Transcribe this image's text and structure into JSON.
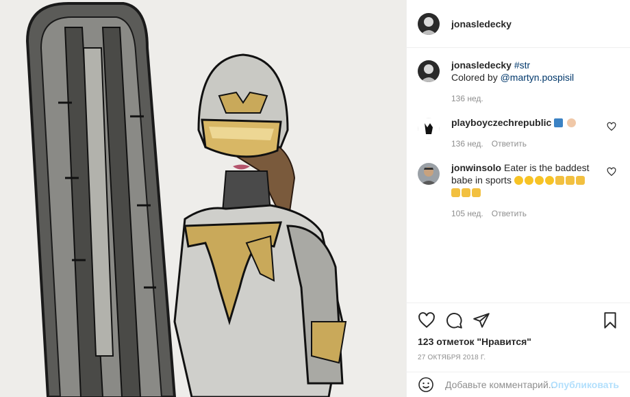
{
  "post": {
    "author": "jonasledecky",
    "media_label": "illustration-female-rider-with-snowboard"
  },
  "caption": {
    "author": "jonasledecky",
    "hashtag": "#str",
    "line2_prefix": "Colored by ",
    "mention": "@martyn.pospisil",
    "time": "136 нед."
  },
  "comments": [
    {
      "author": "playboyczechrepublic",
      "text": "",
      "emoji": [
        "anchor",
        "like"
      ],
      "time": "136 нед.",
      "reply": "Ответить"
    },
    {
      "author": "jonwinsolo",
      "text": "Eater is the baddest babe in sports",
      "emoji": [
        "heart-eyes",
        "heart-eyes",
        "heart-eyes",
        "heart-eyes",
        "horns",
        "horns",
        "horns",
        "horns",
        "horns",
        "horns"
      ],
      "time": "105 нед.",
      "reply": "Ответить"
    }
  ],
  "actions": {
    "likes": "123 отметок \"Нравится\"",
    "date": "27 ОКТЯБРЯ 2018 Г."
  },
  "add_comment": {
    "placeholder": "Добавьте комментарий...",
    "publish": "Опубликовать"
  },
  "colors": {
    "link": "#00376b",
    "muted": "#8e8e8e",
    "publish_disabled": "#b2dffc",
    "gold": "#c9a95a"
  }
}
